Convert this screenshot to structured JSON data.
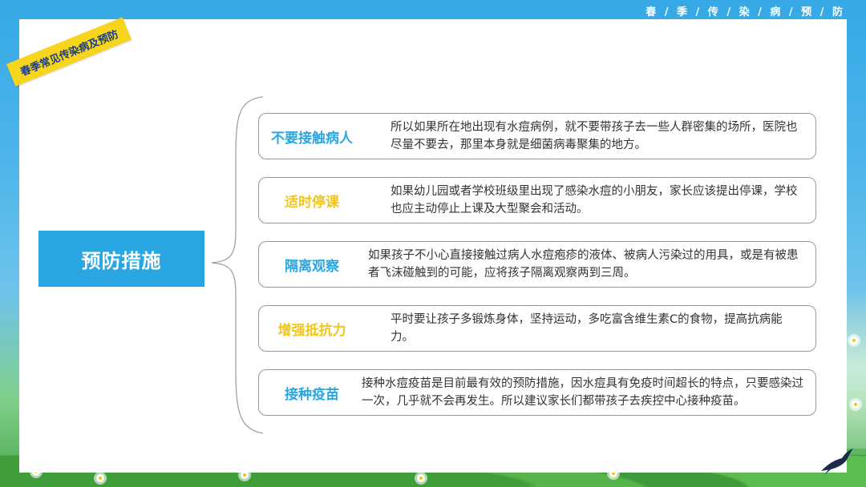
{
  "header": {
    "title": "春 / 季 / 传 / 染 / 病 / 预 / 防"
  },
  "tag": {
    "text": "春季常见传染病及预防"
  },
  "main": {
    "label": "预防措施"
  },
  "colors": {
    "blue": "#2aa7e2",
    "yellow": "#f3c517",
    "tag_yellow": "#f7d51b"
  },
  "items": [
    {
      "title": "不要接触病人",
      "color": "#2aa7e2",
      "text": "所以如果所在地出现有水痘病例，就不要带孩子去一些人群密集的场所，医院也尽量不要去，那里本身就是细菌病毒聚集的地方。"
    },
    {
      "title": "适时停课",
      "color": "#f3c517",
      "text": "如果幼儿园或者学校班级里出现了感染水痘的小朋友，家长应该提出停课，学校也应主动停止上课及大型聚会和活动。"
    },
    {
      "title": "隔离观察",
      "color": "#2aa7e2",
      "text": "如果孩子不小心直接接触过病人水痘疱疹的液体、被病人污染过的用具，或是有被患者飞沫碰触到的可能，应将孩子隔离观察两到三周。"
    },
    {
      "title": "增强抵抗力",
      "color": "#f3c517",
      "text": "平时要让孩子多锻炼身体，坚持运动，多吃富含维生素C的食物，提高抗病能力。"
    },
    {
      "title": "接种疫苗",
      "color": "#2aa7e2",
      "text": "接种水痘疫苗是目前最有效的预防措施，因水痘具有免疫时间超长的特点，只要感染过一次，几乎就不会再发生。所以建议家长们都带孩子去疾控中心接种疫苗。"
    }
  ]
}
